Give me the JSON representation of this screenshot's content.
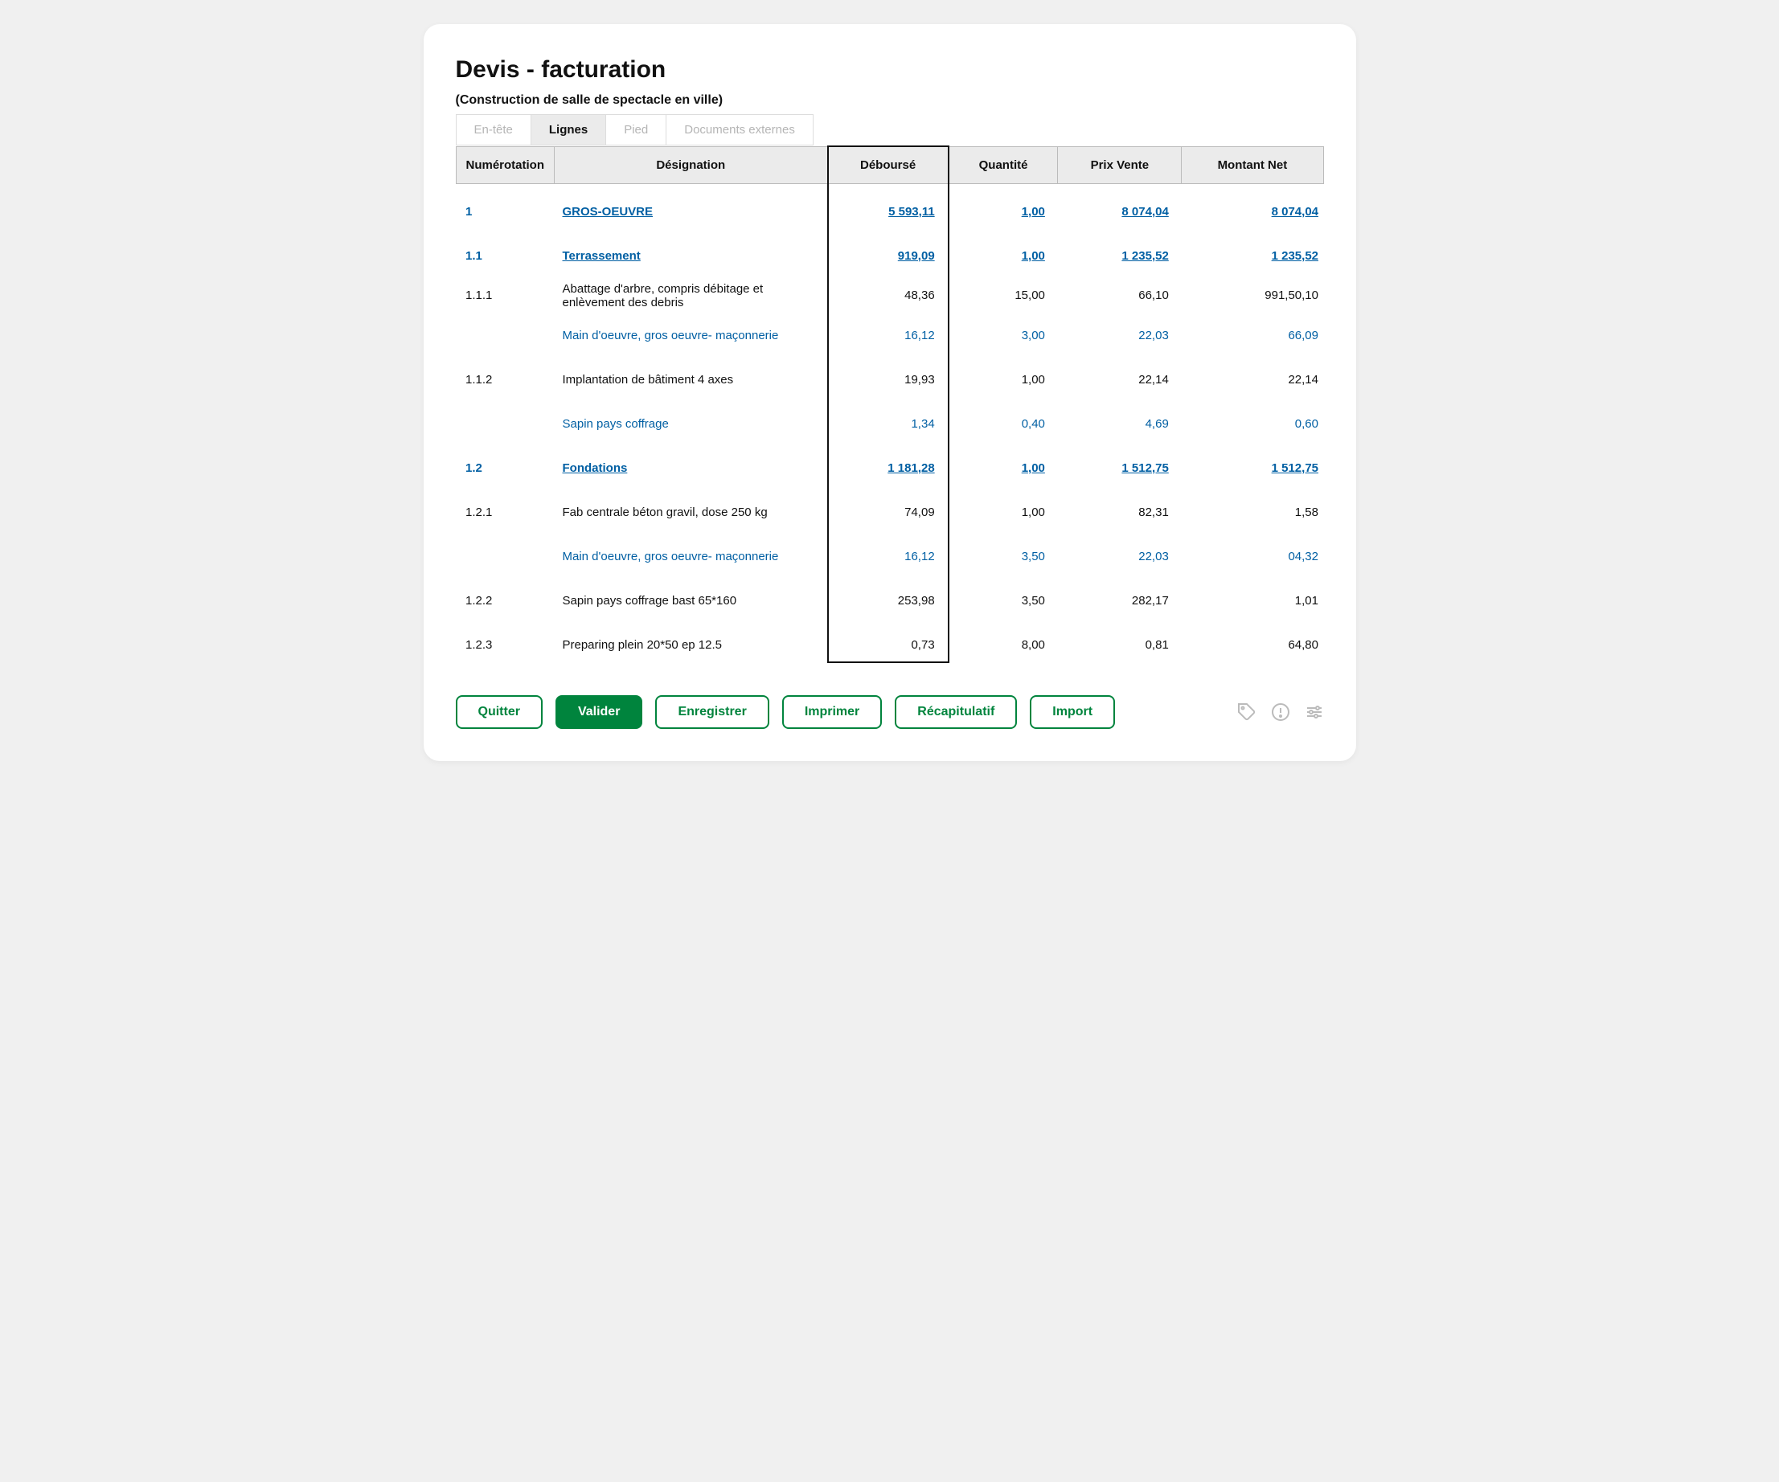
{
  "title": "Devis - facturation",
  "subtitle": "(Construction de salle de spectacle en ville)",
  "tabs": {
    "entete": "En-tête",
    "lignes": "Lignes",
    "pied": "Pied",
    "documents": "Documents externes"
  },
  "columns": {
    "num": "Numérotation",
    "des": "Désignation",
    "deb": "Déboursé",
    "qte": "Quantité",
    "pv": "Prix Vente",
    "net": "Montant Net"
  },
  "rows": [
    {
      "level": 1,
      "num": "1",
      "des": "GROS-OEUVRE",
      "deb": "5 593,11",
      "qte": "1,00",
      "pv": "8 074,04",
      "net": "8 074,04"
    },
    {
      "level": 2,
      "num": "1.1",
      "des": "Terrassement",
      "deb": "919,09",
      "qte": "1,00",
      "pv": "1 235,52",
      "net": "1 235,52"
    },
    {
      "level": 3,
      "num": "1.1.1",
      "des": "Abattage d'arbre, compris débitage et enlèvement des debris",
      "deb": "48,36",
      "qte": "15,00",
      "pv": "66,10",
      "net": "991,50,10"
    },
    {
      "level": 4,
      "num": "",
      "des": "Main d'oeuvre, gros oeuvre- maçonnerie",
      "deb": "16,12",
      "qte": "3,00",
      "pv": "22,03",
      "net": "66,09"
    },
    {
      "level": 3,
      "num": "1.1.2",
      "des": "Implantation de bâtiment 4 axes",
      "deb": "19,93",
      "qte": "1,00",
      "pv": "22,14",
      "net": "22,14"
    },
    {
      "level": 4,
      "num": "",
      "des": "Sapin pays coffrage",
      "deb": "1,34",
      "qte": "0,40",
      "pv": "4,69",
      "net": "0,60"
    },
    {
      "level": 2,
      "num": "1.2",
      "des": "Fondations",
      "deb": "1 181,28",
      "qte": "1,00",
      "pv": "1 512,75",
      "net": "1 512,75"
    },
    {
      "level": 3,
      "num": "1.2.1",
      "des": "Fab centrale béton gravil, dose 250 kg",
      "deb": "74,09",
      "qte": "1,00",
      "pv": "82,31",
      "net": "1,58"
    },
    {
      "level": 4,
      "num": "",
      "des": "Main d'oeuvre, gros oeuvre- maçonnerie",
      "deb": "16,12",
      "qte": "3,50",
      "pv": "22,03",
      "net": "04,32"
    },
    {
      "level": 3,
      "num": "1.2.2",
      "des": "Sapin pays coffrage bast 65*160",
      "deb": "253,98",
      "qte": "3,50",
      "pv": "282,17",
      "net": "1,01"
    },
    {
      "level": 3,
      "num": "1.2.3",
      "des": "Preparing plein 20*50 ep 12.5",
      "deb": "0,73",
      "qte": "8,00",
      "pv": "0,81",
      "net": "64,80"
    }
  ],
  "buttons": {
    "quitter": "Quitter",
    "valider": "Valider",
    "enregistrer": "Enregistrer",
    "imprimer": "Imprimer",
    "recapitulatif": "Récapitulatif",
    "import": "Import"
  }
}
